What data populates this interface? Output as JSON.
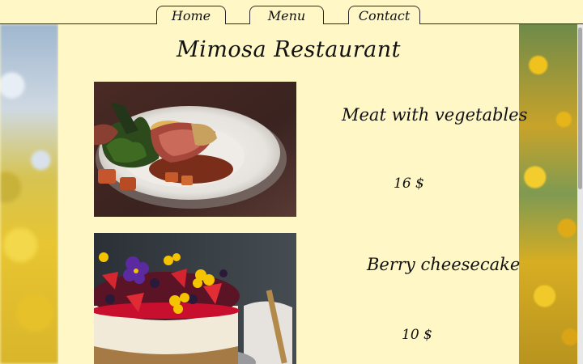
{
  "nav": {
    "tabs": [
      {
        "label": "Home"
      },
      {
        "label": "Menu"
      },
      {
        "label": "Contact"
      }
    ]
  },
  "page": {
    "title": "Mimosa Restaurant"
  },
  "menu": {
    "items": [
      {
        "name": "Meat with vegetables",
        "price": "16 $",
        "image": "meat-dish-photo"
      },
      {
        "name": "Berry cheesecake",
        "price": "10 $",
        "image": "cheesecake-photo"
      }
    ]
  },
  "colors": {
    "background": "#fff7c6",
    "text": "#111111",
    "border": "#2a2a2a"
  }
}
